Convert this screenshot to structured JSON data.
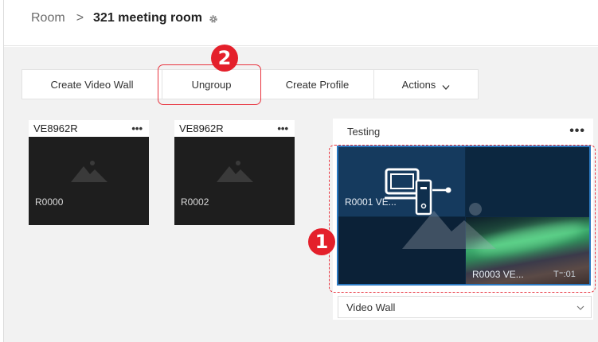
{
  "breadcrumb": {
    "root": "Room",
    "separator": ">",
    "current": "321 meeting room",
    "settings_icon": "gear-icon"
  },
  "toolbar": {
    "create_video_wall": "Create Video Wall",
    "ungroup": "Ungroup",
    "create_profile": "Create Profile",
    "actions": "Actions"
  },
  "annotations": {
    "marker_2": "2",
    "marker_1": "1",
    "color": "#e4202b"
  },
  "devices": [
    {
      "model": "VE8962R",
      "menu": "•••",
      "receiver": "R0000"
    },
    {
      "model": "VE8962R",
      "menu": "•••",
      "receiver": "R0002"
    }
  ],
  "video_wall": {
    "name": "Testing",
    "menu": "•••",
    "screens": [
      {
        "label": "R0001 VE..."
      },
      {
        "label": ""
      },
      {
        "label": ""
      },
      {
        "label": "R0003 VE...",
        "extra": "T⁼:01"
      }
    ],
    "mode_select": {
      "value": "Video Wall"
    }
  },
  "colors": {
    "accent_red": "#e8343f",
    "wall_border": "#2b79c2",
    "panel_bg": "#f2f2f2"
  }
}
